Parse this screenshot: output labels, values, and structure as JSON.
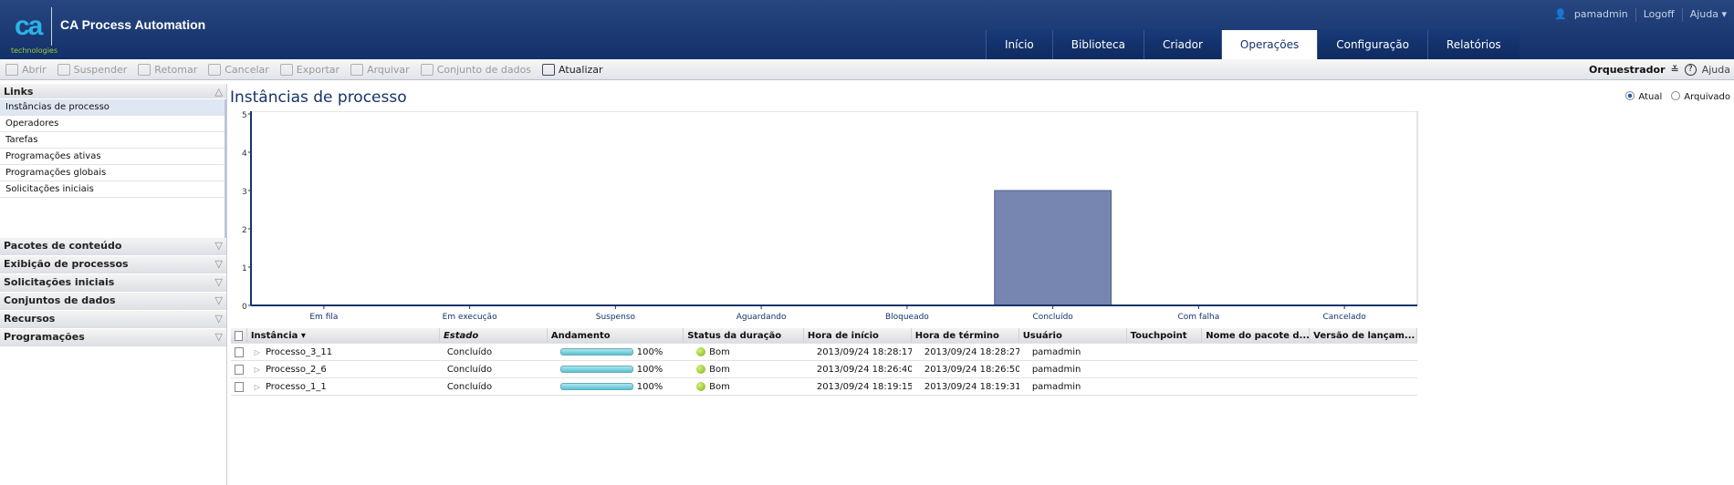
{
  "header": {
    "logo_text": "ca",
    "logo_sub": "technologies",
    "app_title": "CA Process Automation",
    "user": "pamadmin",
    "logoff": "Logoff",
    "help": "Ajuda ▾",
    "tabs": [
      "Início",
      "Biblioteca",
      "Criador",
      "Operações",
      "Configuração",
      "Relatórios"
    ],
    "active_tab": "Operações"
  },
  "toolbar": {
    "items": [
      "Abrir",
      "Suspender",
      "Retomar",
      "Cancelar",
      "Exportar",
      "Arquivar",
      "Conjunto de dados",
      "Atualizar"
    ],
    "orchestrator": "Orquestrador",
    "help": "Ajuda"
  },
  "sidebar": {
    "links_title": "Links",
    "links": [
      "Instâncias de processo",
      "Operadores",
      "Tarefas",
      "Programações ativas",
      "Programações globais",
      "Solicitações iniciais"
    ],
    "sections": [
      "Pacotes de conteúdo",
      "Exibição de processos",
      "Solicitações iniciais",
      "Conjuntos de dados",
      "Recursos",
      "Programações"
    ]
  },
  "main": {
    "title": "Instâncias de processo",
    "radio_current": "Atual",
    "radio_archived": "Arquivado"
  },
  "chart_data": {
    "type": "bar",
    "categories": [
      "Em fila",
      "Em execução",
      "Suspenso",
      "Aguardando",
      "Bloqueado",
      "Concluído",
      "Com falha",
      "Cancelado"
    ],
    "values": [
      0,
      0,
      0,
      0,
      0,
      3,
      0,
      0
    ],
    "ylim": [
      0,
      5
    ],
    "yticks": [
      "0",
      "1",
      "2",
      "3",
      "4",
      "5"
    ],
    "bar_color": "#7686b0",
    "axis_color": "#16336b"
  },
  "table": {
    "columns": [
      "Instância ▾",
      "Estado",
      "Andamento",
      "Status da duração",
      "Hora de início",
      "Hora de término",
      "Usuário",
      "Touchpoint",
      "Nome do pacote d...",
      "Versão de lançam..."
    ],
    "rows": [
      {
        "instance": "Processo_3_11",
        "state": "Concluído",
        "progress": "100%",
        "status": "Bom",
        "start": "2013/09/24 18:28:17",
        "end": "2013/09/24 18:28:27",
        "user": "pamadmin"
      },
      {
        "instance": "Processo_2_6",
        "state": "Concluído",
        "progress": "100%",
        "status": "Bom",
        "start": "2013/09/24 18:26:40",
        "end": "2013/09/24 18:26:50",
        "user": "pamadmin"
      },
      {
        "instance": "Processo_1_1",
        "state": "Concluído",
        "progress": "100%",
        "status": "Bom",
        "start": "2013/09/24 18:19:15",
        "end": "2013/09/24 18:19:31",
        "user": "pamadmin"
      }
    ]
  }
}
